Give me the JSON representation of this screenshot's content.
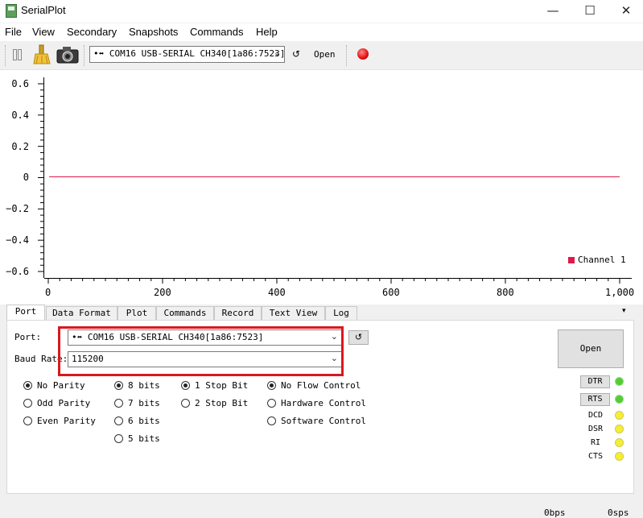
{
  "window": {
    "title": "SerialPlot"
  },
  "menu": [
    "File",
    "View",
    "Secondary",
    "Snapshots",
    "Commands",
    "Help"
  ],
  "toolbar": {
    "port_combo": "•⬌ COM16 USB-SERIAL CH340[1a86:7523]",
    "refresh": "↺",
    "open_label": "Open"
  },
  "plot": {
    "y_ticks": [
      "0.6",
      "0.4",
      "0.2",
      "0",
      "−0.2",
      "−0.4",
      "−0.6"
    ],
    "x_ticks": [
      "0",
      "200",
      "400",
      "600",
      "800",
      "1,000"
    ],
    "legend": "Channel 1",
    "series_color": "#e0194c"
  },
  "tabs": [
    "Port",
    "Data Format",
    "Plot",
    "Commands",
    "Record",
    "Text View",
    "Log"
  ],
  "tabs_more": "▾",
  "port_tab": {
    "port_label": "Port:",
    "port_value": "•⬌ COM16 USB-SERIAL CH340[1a86:7523]",
    "refresh": "↺",
    "baud_label": "Baud Rate:",
    "baud_value": "115200",
    "open_button": "Open",
    "parity": {
      "options": [
        "No Parity",
        "Odd Parity",
        "Even Parity"
      ],
      "selected": "No Parity"
    },
    "data_bits": {
      "options": [
        "8 bits",
        "7 bits",
        "6 bits",
        "5 bits"
      ],
      "selected": "8 bits"
    },
    "stop_bits": {
      "options": [
        "1 Stop Bit",
        "2 Stop Bit"
      ],
      "selected": "1 Stop Bit"
    },
    "flow": {
      "options": [
        "No Flow Control",
        "Hardware Control",
        "Software Control"
      ],
      "selected": "No Flow Control"
    },
    "pins": {
      "dtr": "DTR",
      "rts": "RTS",
      "dcd": "DCD",
      "dsr": "DSR",
      "ri": "RI",
      "cts": "CTS"
    }
  },
  "status": {
    "left": "0bps",
    "right": "0sps"
  }
}
